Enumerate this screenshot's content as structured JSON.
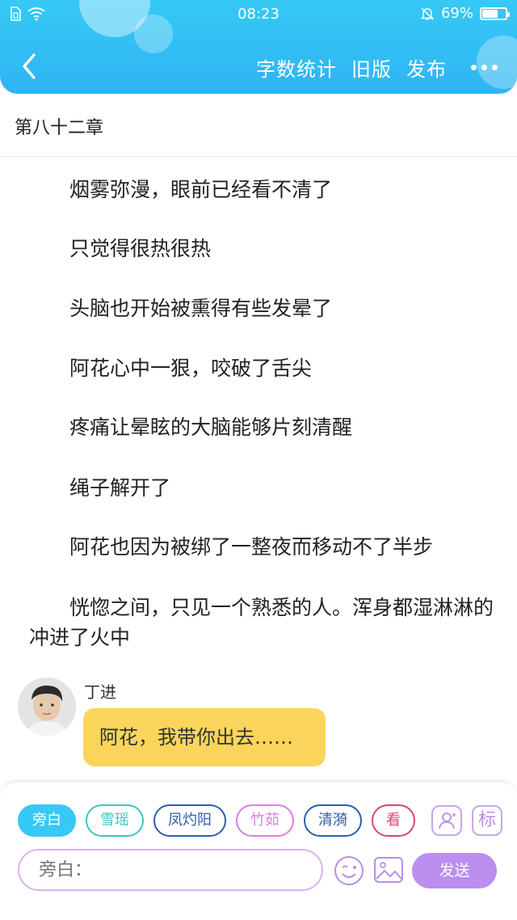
{
  "status_bar": {
    "time": "08:23",
    "battery": "69%",
    "battery_level": 0.69
  },
  "header": {
    "back_icon": "chevron-left-icon",
    "actions": [
      "字数统计",
      "旧版",
      "发布"
    ],
    "more_icon": "more-dots-icon"
  },
  "chapter": {
    "title": "第八十二章"
  },
  "content": {
    "paragraphs": [
      "烟雾弥漫，眼前已经看不清了",
      "只觉得很热很热",
      "头脑也开始被熏得有些发晕了",
      "阿花心中一狠，咬破了舌尖",
      "疼痛让晕眩的大脑能够片刻清醒",
      "绳子解开了",
      "阿花也因为被绑了一整夜而移动不了半步",
      "恍惚之间，只见一个熟悉的人。浑身都湿淋淋的冲进了火中"
    ],
    "dialogue": {
      "speaker": "丁进",
      "message": "阿花，我带你出去……"
    }
  },
  "composer": {
    "roles": [
      {
        "label": "旁白",
        "color": "#36c9f5"
      },
      {
        "label": "雪瑶",
        "color": "#3cc6c0"
      },
      {
        "label": "凤灼阳",
        "color": "#2f5fa8"
      },
      {
        "label": "竹茹",
        "color": "#e07de0"
      },
      {
        "label": "清漪",
        "color": "#2f5fa8"
      },
      {
        "label": "看",
        "color": "#d9447d"
      }
    ],
    "mark_label": "标",
    "input_placeholder": "旁白：",
    "send_label": "发送",
    "accent": "#bb8ef0"
  }
}
